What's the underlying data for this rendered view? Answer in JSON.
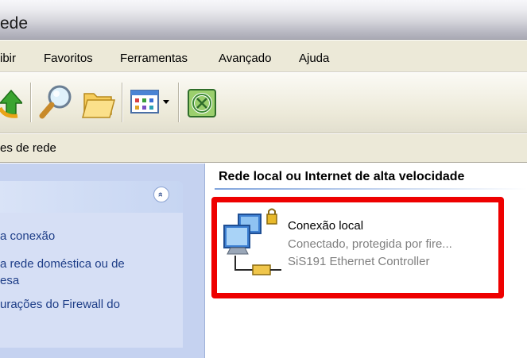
{
  "window": {
    "title": "ede"
  },
  "menu": {
    "items": [
      {
        "label": "ibir"
      },
      {
        "label": "Favoritos"
      },
      {
        "label": "Ferramentas"
      },
      {
        "label": "Avançado"
      },
      {
        "label": "Ajuda"
      }
    ]
  },
  "toolbar": {
    "icons": [
      "up-folder-icon",
      "search-icon",
      "folders-icon",
      "view-menu-icon",
      "network-connections-icon"
    ]
  },
  "address": {
    "text": "es de rede"
  },
  "task_pane": {
    "collapse_glyph": "»",
    "links": [
      {
        "line1": "a conexão"
      },
      {
        "line1": "a rede doméstica ou de",
        "line2": "esa"
      },
      {
        "line1": "urações do Firewall do"
      }
    ]
  },
  "main": {
    "group_header": "Rede local ou Internet de alta velocidade",
    "connection": {
      "name": "Conexão local",
      "status": "Conectado, protegida por fire...",
      "device": "SiS191 Ethernet Controller"
    }
  },
  "colors": {
    "highlight": "#ee0000",
    "task_pane_bg": "#c5d2f0",
    "link": "#1d3d87"
  }
}
